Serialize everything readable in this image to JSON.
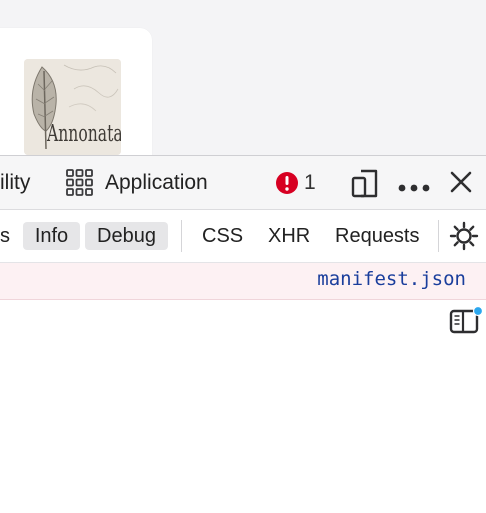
{
  "page": {
    "image_label": "Annonatate"
  },
  "devtools": {
    "tabs": {
      "partial_tab_label": "ility",
      "application_label": "Application",
      "error_count": "1"
    },
    "filters": {
      "partial_label": "s",
      "info_label": "Info",
      "debug_label": "Debug",
      "css_label": "CSS",
      "xhr_label": "XHR",
      "requests_label": "Requests"
    },
    "console": {
      "source_link": "manifest.json"
    },
    "colors": {
      "error_red": "#d70022",
      "link_blue": "#1a3e9c",
      "notification_dot": "#2ba7ee"
    }
  }
}
